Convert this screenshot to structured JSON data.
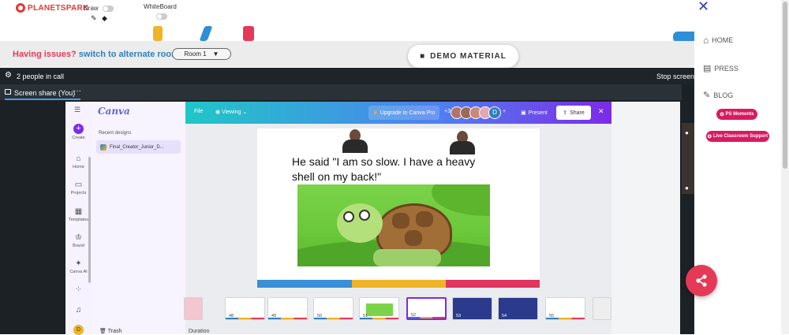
{
  "topbar": {
    "logo": "PLANETSPARK",
    "draw_label": "Draw",
    "whiteboard_label": "WhiteBoard"
  },
  "issues": {
    "prefix": "Having issues?",
    "link": "switch to alternate room",
    "room_value": "Room 1"
  },
  "demo_button": "DEMO MATERIAL",
  "call": {
    "people": "2 people in call",
    "stop": "Stop screen",
    "tab_label": "Screen share (You)",
    "tab_menu": "···"
  },
  "canva": {
    "logo": "Canva",
    "rail": [
      "Create",
      "Home",
      "Projects",
      "Templates",
      "Brand",
      "Canva AI"
    ],
    "recent_heading": "Recent designs",
    "recent_item": "Final_Creator_Junior_D...",
    "trash": "Trash",
    "menu_file": "File",
    "viewing": "Viewing",
    "upgrade": "Upgrade to Canva Pro",
    "collab_count": "+34",
    "avatar_letter": "D",
    "present": "Present",
    "share": "Share"
  },
  "slide": {
    "text": "He said \"I am so slow. I have a heavy shell on my back!\"",
    "stripe_colors": [
      "#3a8fd6",
      "#f0b429",
      "#e0355e"
    ]
  },
  "page_thumbs": [
    {
      "num": "",
      "type": "partial"
    },
    {
      "num": "48",
      "type": "text"
    },
    {
      "num": "49",
      "type": "text"
    },
    {
      "num": "50",
      "type": "text"
    },
    {
      "num": "51",
      "type": "turtle"
    },
    {
      "num": "52",
      "type": "active"
    },
    {
      "num": "53",
      "type": "dark"
    },
    {
      "num": "54",
      "type": "dark"
    },
    {
      "num": "55",
      "type": "text"
    },
    {
      "num": "",
      "type": "partial"
    }
  ],
  "bottom_partial": "Duration",
  "sidebar": {
    "home": "HOME",
    "press": "PRESS",
    "blog": "BLOG",
    "ps_moments": "PS Moments",
    "live_support": "Live Classroom Support"
  },
  "colors": {
    "accent_red": "#e53958",
    "link_blue": "#2f7fc1",
    "canva_purple": "#7d2ae8"
  }
}
